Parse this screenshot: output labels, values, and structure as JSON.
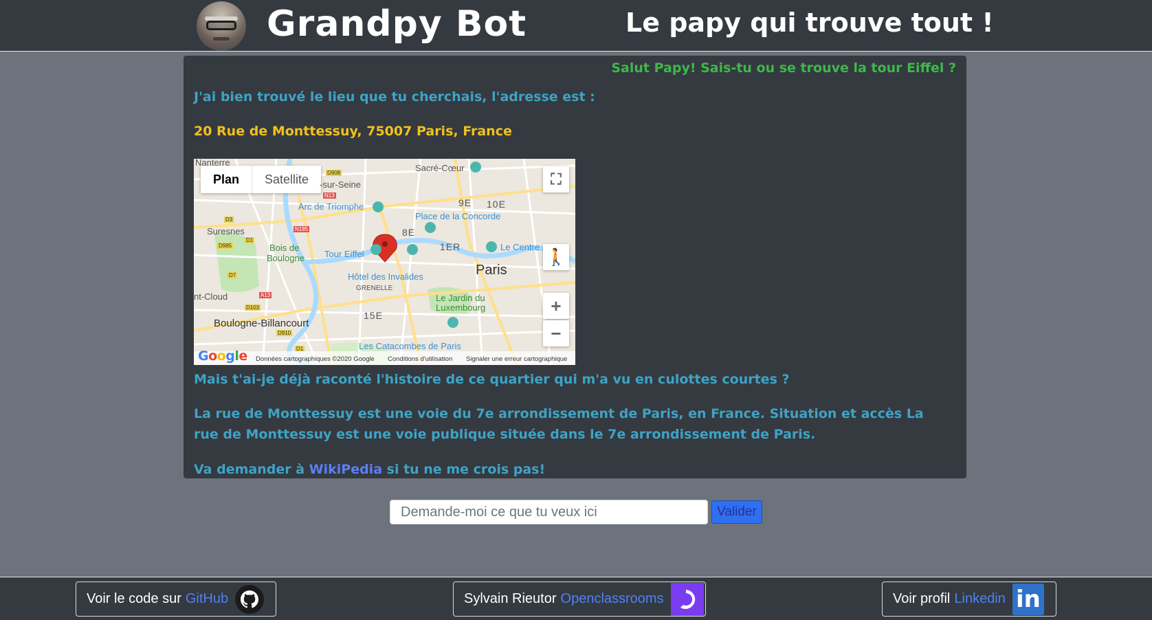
{
  "header": {
    "title": "Grandpy Bot",
    "subtitle": "Le papy qui trouve tout !"
  },
  "chat": {
    "user_message": "Salut Papy! Sais-tu ou se trouve la tour Eiffel ?",
    "bot_found": "J'ai bien trouvé le lieu que tu cherchais, l'adresse est :",
    "address": "20 Rue de Monttessuy, 75007 Paris, France",
    "story_intro": "Mais t'ai-je déjà raconté l'histoire de ce quartier qui m'a vu en culottes courtes ?",
    "description": "La rue de Monttessuy est une voie du 7e arrondissement de Paris, en France. Situation et accès La rue de Monttessuy est une voie publique située dans le 7e arrondissement de Paris.",
    "wiki_prefix": "Va demander à ",
    "wiki_link": "WikiPedia",
    "wiki_suffix": " si tu ne me crois pas!"
  },
  "map": {
    "tabs": [
      "Plan",
      "Satellite"
    ],
    "labels": {
      "nanterre": "Nanterre",
      "sur_seine": "-sur-Seine",
      "sacre_coeur": "Sacré-Cœur",
      "arc": "Arc de Triomphe",
      "concorde": "Place de la Concorde",
      "suresnes": "Suresnes",
      "bois": "Bois de",
      "boulogne_bois": "Boulogne",
      "tour_eiffel": "Tour Eiffel",
      "centre": "Le Centre",
      "paris": "Paris",
      "invalides": "Hôtel des Invalides",
      "grenelle": "GRENELLE",
      "cloud": "nt-Cloud",
      "jardin": "Le Jardin du",
      "luxembourg": "Luxembourg",
      "boulogne_b": "Boulogne-Billancourt",
      "catacombes": "Les Catacombes de Paris",
      "arr_9": "9E",
      "arr_10": "10E",
      "arr_8": "8E",
      "arr_1": "1ER",
      "arr_15": "15E",
      "road_d908": "D908",
      "road_n13": "N13",
      "road_d3": "D3",
      "road_n185": "N185",
      "road_d1": "D1",
      "road_d985": "D985",
      "road_d7": "D7",
      "road_a13": "A13",
      "road_d103": "D103",
      "road_d910": "D910",
      "road_d1b": "D1"
    },
    "footer": {
      "logo": "Google",
      "data": "Données cartographiques ©2020 Google",
      "terms": "Conditions d'utilisation",
      "report": "Signaler une erreur cartographique"
    },
    "colors": {
      "pin": "#d93025",
      "water": "#aadaff",
      "park": "#c3e6b4",
      "road": "#ffe9a6"
    }
  },
  "search": {
    "placeholder": "Demande-moi ce que tu veux ici",
    "value": "",
    "button": "Valider"
  },
  "footer": {
    "github_text": "Voir le code sur",
    "github_link": "GitHub",
    "oc_text": "Sylvain Rieutor",
    "oc_link": "Openclassrooms",
    "linkedin_text": "Voir profil",
    "linkedin_link": "Linkedin",
    "linkedin_icon_text": "in"
  },
  "colors": {
    "user_msg": "#3fb84a",
    "bot_msg": "#3fa3c6",
    "address": "#f2c11e",
    "link": "#5d7ef5",
    "panel": "#343a40",
    "background": "#6c737c"
  }
}
